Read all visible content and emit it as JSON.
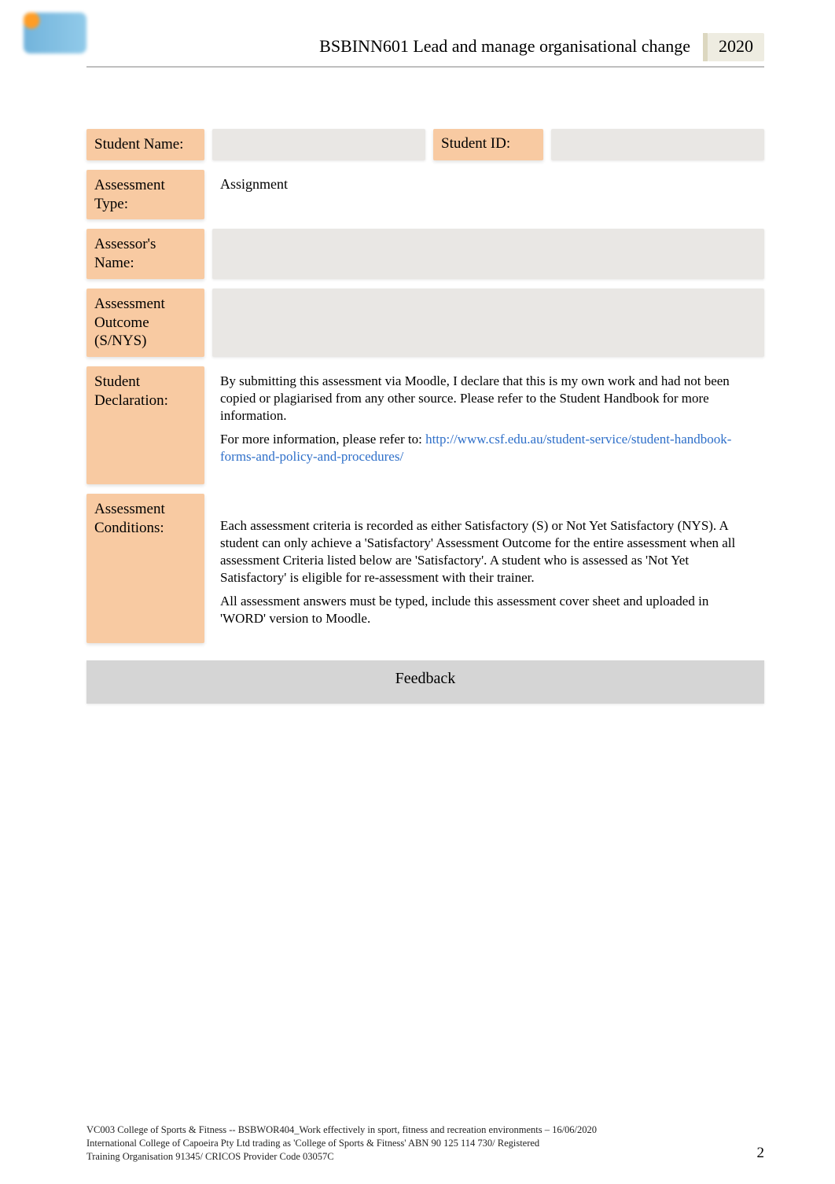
{
  "header": {
    "unit_title": "BSBINN601 Lead and manage organisational change",
    "year": "2020"
  },
  "rows": {
    "student_name": {
      "label": "Student Name:",
      "value": ""
    },
    "student_id": {
      "label": "Student ID:",
      "value": ""
    },
    "assessment_type": {
      "label": "Assessment Type:",
      "value": "Assignment"
    },
    "assessor_name": {
      "label": "Assessor's Name:",
      "value": ""
    },
    "assessment_outcome": {
      "label": "Assessment Outcome (S/NYS)",
      "value": ""
    },
    "student_declaration": {
      "label": "Student Declaration:",
      "para1": "By submitting this assessment via Moodle, I declare that this is my own work and had not been copied or plagiarised from any other source. Please refer to the Student Handbook for more information.",
      "para2_prefix": "For more information, please refer to:  ",
      "link_text": "http://www.csf.edu.au/student-service/student-handbook-forms-and-policy-and-procedures/"
    },
    "assessment_conditions": {
      "label": "Assessment Conditions:",
      "para1": "Each assessment criteria is recorded as either Satisfactory (S) or Not Yet Satisfactory (NYS). A student can only achieve a 'Satisfactory' Assessment Outcome for the entire assessment when all assessment Criteria listed below are 'Satisfactory'. A student who is assessed as 'Not Yet Satisfactory' is eligible for re-assessment with their trainer.",
      "para2": "All assessment answers must be typed, include this assessment cover sheet and uploaded in 'WORD' version to Moodle."
    }
  },
  "feedback_heading": "Feedback",
  "footer": {
    "line1": "VC003 College of Sports & Fitness -- BSBWOR404_Work effectively in sport, fitness and recreation environments – 16/06/2020",
    "line2": "International College of Capoeira Pty Ltd trading as 'College of Sports & Fitness' ABN 90 125 114 730/ Registered",
    "line3": "Training Organisation 91345/ CRICOS Provider Code 03057C",
    "page_number": "2"
  }
}
